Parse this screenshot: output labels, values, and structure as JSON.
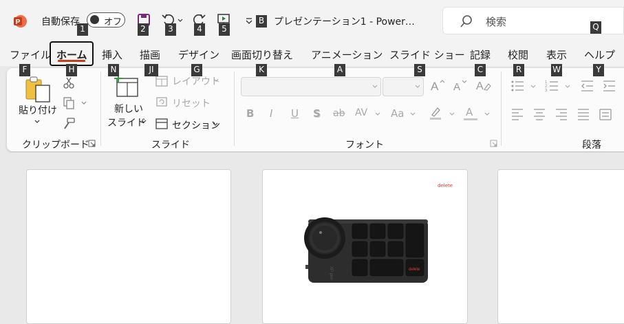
{
  "titlebar": {
    "autosave_label": "自動保存",
    "autosave_state": "オフ",
    "title": "プレゼンテーション1  -  Power…",
    "search_placeholder": "検索"
  },
  "keytips": {
    "autosave": "1",
    "save": "2",
    "undo": "3",
    "redo": "4",
    "start": "5",
    "customize": "B",
    "search": "Q",
    "file": "F",
    "home": "H",
    "insert": "N",
    "draw": "JI",
    "design": "G",
    "transitions": "K",
    "animations": "A",
    "slideshow": "S",
    "review_rec": "C",
    "review": "R",
    "view": "W",
    "help": "Y"
  },
  "tabs": {
    "file": "ファイル",
    "home": "ホーム",
    "insert": "挿入",
    "draw": "描画",
    "design": "デザイン",
    "transitions": "画面切り替え",
    "animations": "アニメーション",
    "slideshow": "スライド ショー",
    "record": "記録",
    "review": "校閲",
    "view": "表示",
    "help": "ヘルプ"
  },
  "ribbon": {
    "clipboard": {
      "paste": "貼り付け",
      "group": "クリップボード"
    },
    "slides": {
      "new_slide_1": "新しい",
      "new_slide_2": "スライド",
      "layout": "レイアウト",
      "reset": "リセット",
      "section": "セクション",
      "group": "スライド"
    },
    "font": {
      "group": "フォント",
      "bold": "B",
      "italic": "I",
      "underline": "U",
      "shadow": "S",
      "strike": "ab",
      "spacing": "AV",
      "case": "Aa",
      "fontcolor": "A"
    },
    "paragraph": {
      "group": "段落"
    }
  },
  "slides": {
    "slide2": {
      "delete_label": "delete",
      "key_label": "delete",
      "brand": "XP pen"
    }
  },
  "colors": {
    "accent": "#c43e1c",
    "logo": "#d35230",
    "delete_red": "#e53935"
  }
}
